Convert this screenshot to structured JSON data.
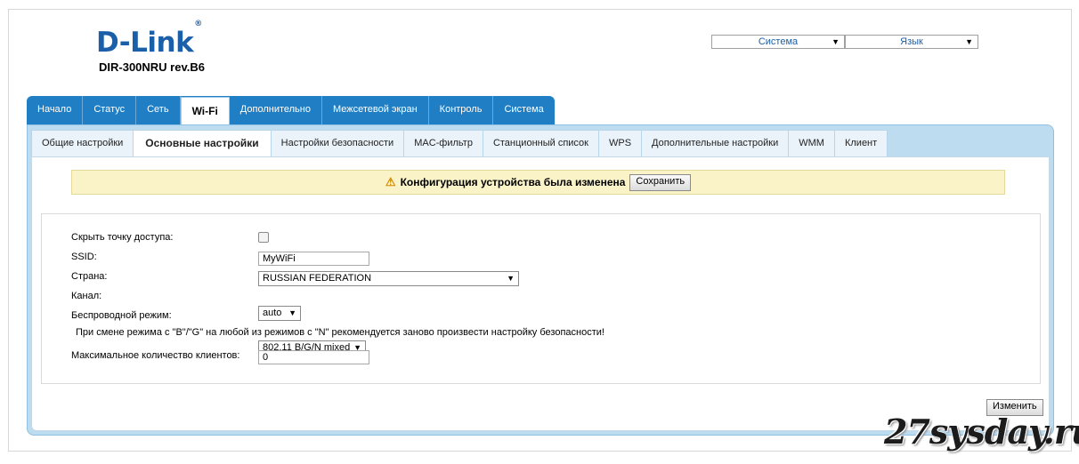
{
  "header": {
    "logo_text": "D-Link",
    "logo_mark": "®",
    "model": "DIR-300NRU rev.B6",
    "system_select": "Система",
    "language_select": "Язык"
  },
  "top_tabs": [
    "Начало",
    "Статус",
    "Сеть",
    "Wi-Fi",
    "Дополнительно",
    "Межсетевой экран",
    "Контроль",
    "Система"
  ],
  "top_tab_active": "Wi-Fi",
  "sub_tabs": [
    "Общие настройки",
    "Основные настройки",
    "Настройки безопасности",
    "MAC-фильтр",
    "Станционный список",
    "WPS",
    "Дополнительные настройки",
    "WMM",
    "Клиент"
  ],
  "sub_tab_active": "Основные настройки",
  "notice": {
    "text": "Конфигурация устройства была изменена",
    "save_label": "Сохранить"
  },
  "form": {
    "hide_ap_label": "Скрыть точку доступа:",
    "hide_ap_checked": false,
    "ssid_label": "SSID:",
    "ssid_value": "MyWiFi",
    "country_label": "Страна:",
    "country_value": "RUSSIAN FEDERATION",
    "channel_label": "Канал:",
    "channel_value": "auto",
    "mode_label": "Беспроводной режим:",
    "mode_value": "802.11 B/G/N mixed",
    "mode_hint": "При смене режима с \"B\"/\"G\" на любой из режимов с \"N\" рекомендуется заново произвести настройку безопасности!",
    "max_clients_label": "Максимальное количество клиентов:",
    "max_clients_value": "0"
  },
  "apply_label": "Изменить",
  "watermark": "27sysday.ru"
}
